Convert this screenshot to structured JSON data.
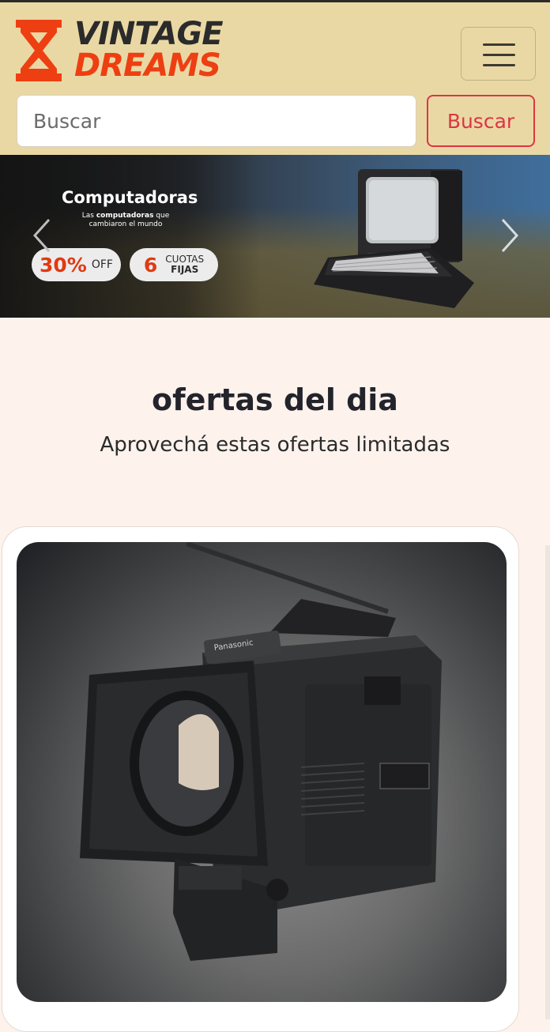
{
  "brand": {
    "line1": "VINTAGE",
    "line2": "DREAMS",
    "colors": {
      "dark": "#2b2b2b",
      "accent": "#ee3f12",
      "header_bg": "#ead8a4"
    }
  },
  "header": {
    "menu_icon": "hamburger-icon"
  },
  "search": {
    "placeholder": "Buscar",
    "button_label": "Buscar",
    "button_color": "#dc3545"
  },
  "carousel": {
    "slide": {
      "title": "Computadoras",
      "subtitle_pre": "Las ",
      "subtitle_bold": "computadoras",
      "subtitle_post": " que cambiaron el mundo",
      "discount_value": "30%",
      "discount_label": "OFF",
      "installments_value": "6",
      "installments_label1": "CUOTAS",
      "installments_label2": "FIJAS"
    },
    "prev_icon": "chevron-left-icon",
    "next_icon": "chevron-right-icon"
  },
  "offers": {
    "title": "ofertas del dia",
    "subtitle": "Aprovechá estas ofertas limitadas"
  },
  "product_card": {
    "image": "vintage-video-camera-image",
    "camera_brand": "Panasonic"
  }
}
